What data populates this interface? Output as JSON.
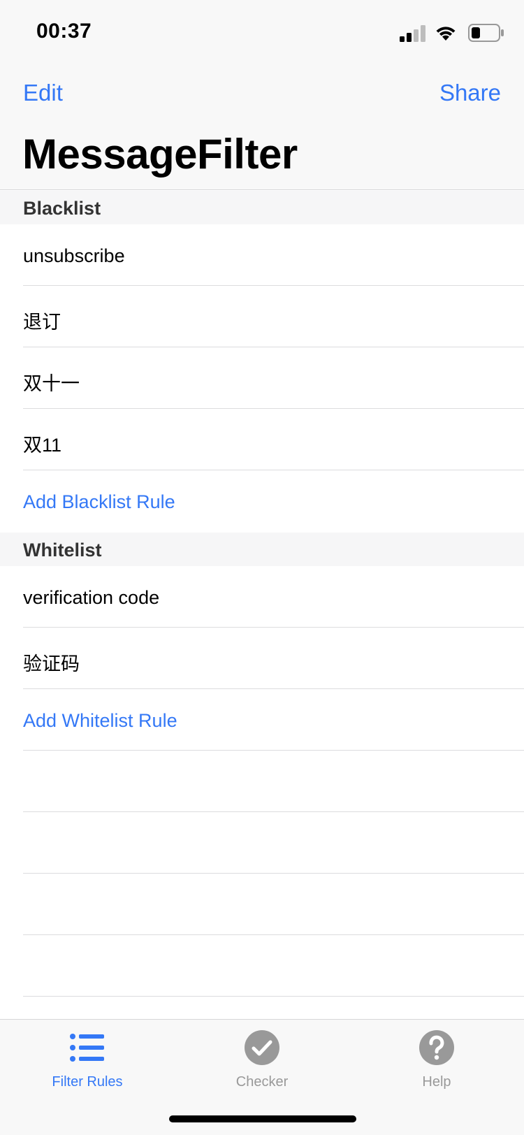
{
  "status_bar": {
    "time": "00:37"
  },
  "nav": {
    "edit_label": "Edit",
    "share_label": "Share",
    "title": "MessageFilter"
  },
  "blacklist": {
    "header": "Blacklist",
    "rules": [
      "unsubscribe",
      "退订",
      "双十一",
      "双11"
    ],
    "add_label": "Add Blacklist Rule"
  },
  "whitelist": {
    "header": "Whitelist",
    "rules": [
      "verification code",
      "验证码"
    ],
    "add_label": "Add Whitelist Rule"
  },
  "tabbar": {
    "tabs": [
      {
        "label": "Filter Rules",
        "icon": "list-icon",
        "active": true
      },
      {
        "label": "Checker",
        "icon": "checkmark-circle-icon",
        "active": false
      },
      {
        "label": "Help",
        "icon": "question-circle-icon",
        "active": false
      }
    ]
  },
  "colors": {
    "accent": "#3478f6",
    "inactive_tab": "#999999"
  }
}
